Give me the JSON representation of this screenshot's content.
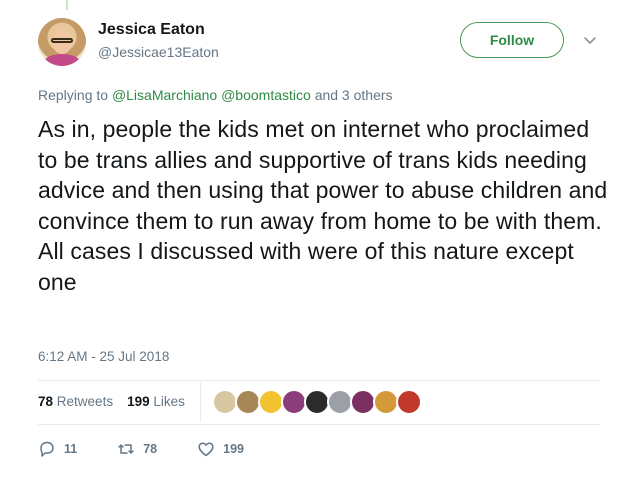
{
  "author": {
    "name": "Jessica Eaton",
    "handle": "@Jessicae13Eaton"
  },
  "follow_label": "Follow",
  "replying": {
    "prefix": "Replying to",
    "mention1": "@LisaMarchiano",
    "mention2": "@boomtastico",
    "suffix": "and 3 others"
  },
  "tweet": {
    "text": "As in, people the kids met on internet who proclaimed to be trans allies and supportive of trans kids needing advice and then using that power to abuse children and convince them to run away from home to be with them. All cases I discussed with were of this nature except one",
    "timestamp": "6:12 AM - 25 Jul 2018"
  },
  "stats": {
    "retweets_count": "78",
    "retweets_label": "Retweets",
    "likes_count": "199",
    "likes_label": "Likes"
  },
  "likers": [
    {
      "color": "#d9c7a1"
    },
    {
      "color": "#a58855"
    },
    {
      "color": "#f2c230"
    },
    {
      "color": "#8a3d7a"
    },
    {
      "color": "#2b2b2b"
    },
    {
      "color": "#9aa0a6"
    },
    {
      "color": "#7a3060"
    },
    {
      "color": "#d49a3a"
    },
    {
      "color": "#c0392b"
    }
  ],
  "actions": {
    "reply_count": "11",
    "retweet_count": "78",
    "like_count": "199"
  },
  "colors": {
    "accent": "#2f8a44",
    "muted": "#657786"
  }
}
